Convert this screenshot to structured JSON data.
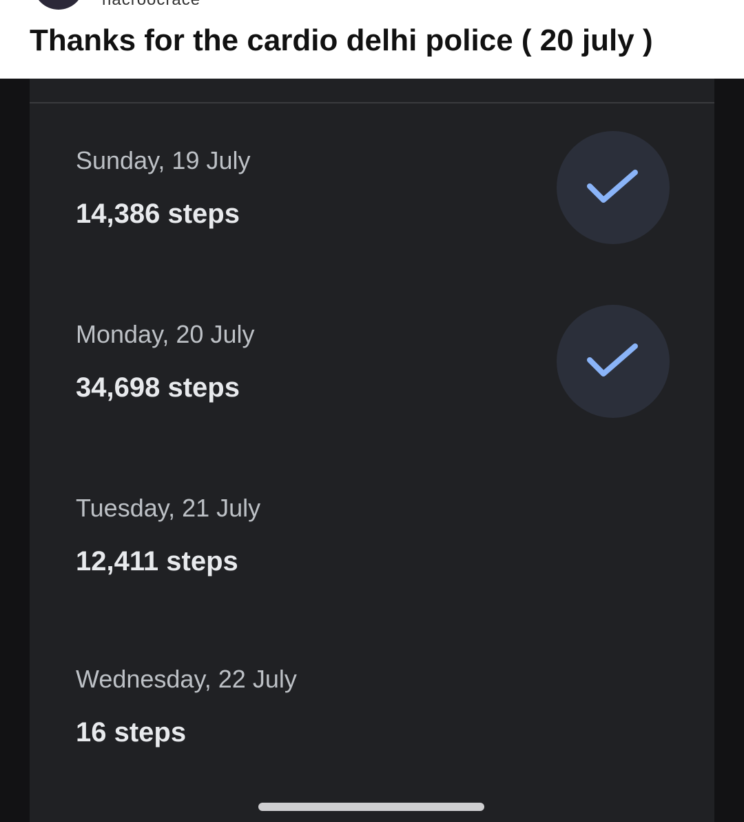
{
  "post": {
    "username": "nacroocrace",
    "caption": "Thanks for the cardio delhi police ( 20 july )"
  },
  "step_log": {
    "days": [
      {
        "date": "Sunday, 19 July",
        "steps": "14,386 steps",
        "goal_met": true
      },
      {
        "date": "Monday, 20 July",
        "steps": "34,698 steps",
        "goal_met": true
      },
      {
        "date": "Tuesday, 21 July",
        "steps": "12,411 steps",
        "goal_met": false
      },
      {
        "date": "Wednesday, 22 July",
        "steps": "16 steps",
        "goal_met": false
      }
    ]
  },
  "colors": {
    "accent_check": "#8ab4f8",
    "screen_bg": "#202124",
    "badge_bg": "#2b2f3a"
  }
}
